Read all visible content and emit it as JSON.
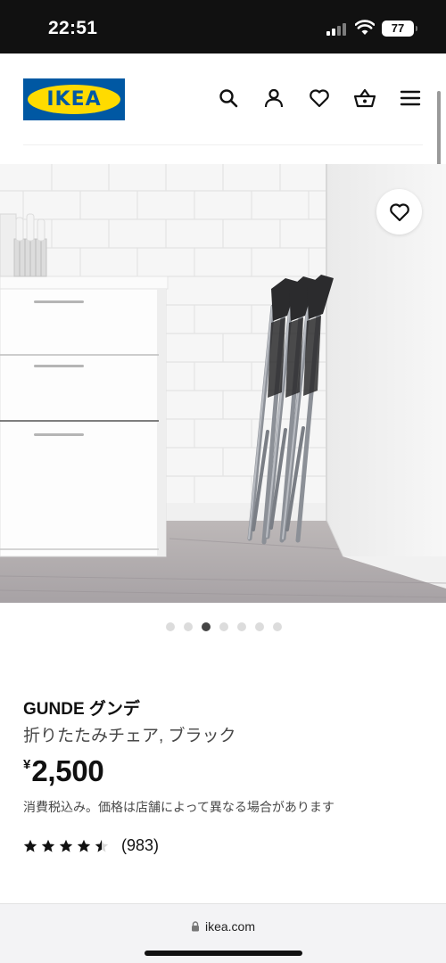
{
  "status_bar": {
    "time": "22:51",
    "battery": "77"
  },
  "header": {
    "logo_text": "IKEA",
    "icons": [
      "search-icon",
      "account-icon",
      "heart-icon",
      "basket-icon",
      "menu-icon"
    ]
  },
  "gallery": {
    "total_images": 7,
    "active_index": 2
  },
  "product": {
    "name": "GUNDE グンデ",
    "description": "折りたたみチェア, ブラック",
    "price_currency": "¥",
    "price_value": "2,500",
    "price_note": "消費税込み。価格は店舗によって異なる場合があります",
    "rating_value": 4.5,
    "rating_max": 5,
    "review_count": "(983)"
  },
  "browser": {
    "url": "ikea.com"
  },
  "colors": {
    "ikea_blue": "#0058a3",
    "ikea_yellow": "#ffdb00"
  }
}
